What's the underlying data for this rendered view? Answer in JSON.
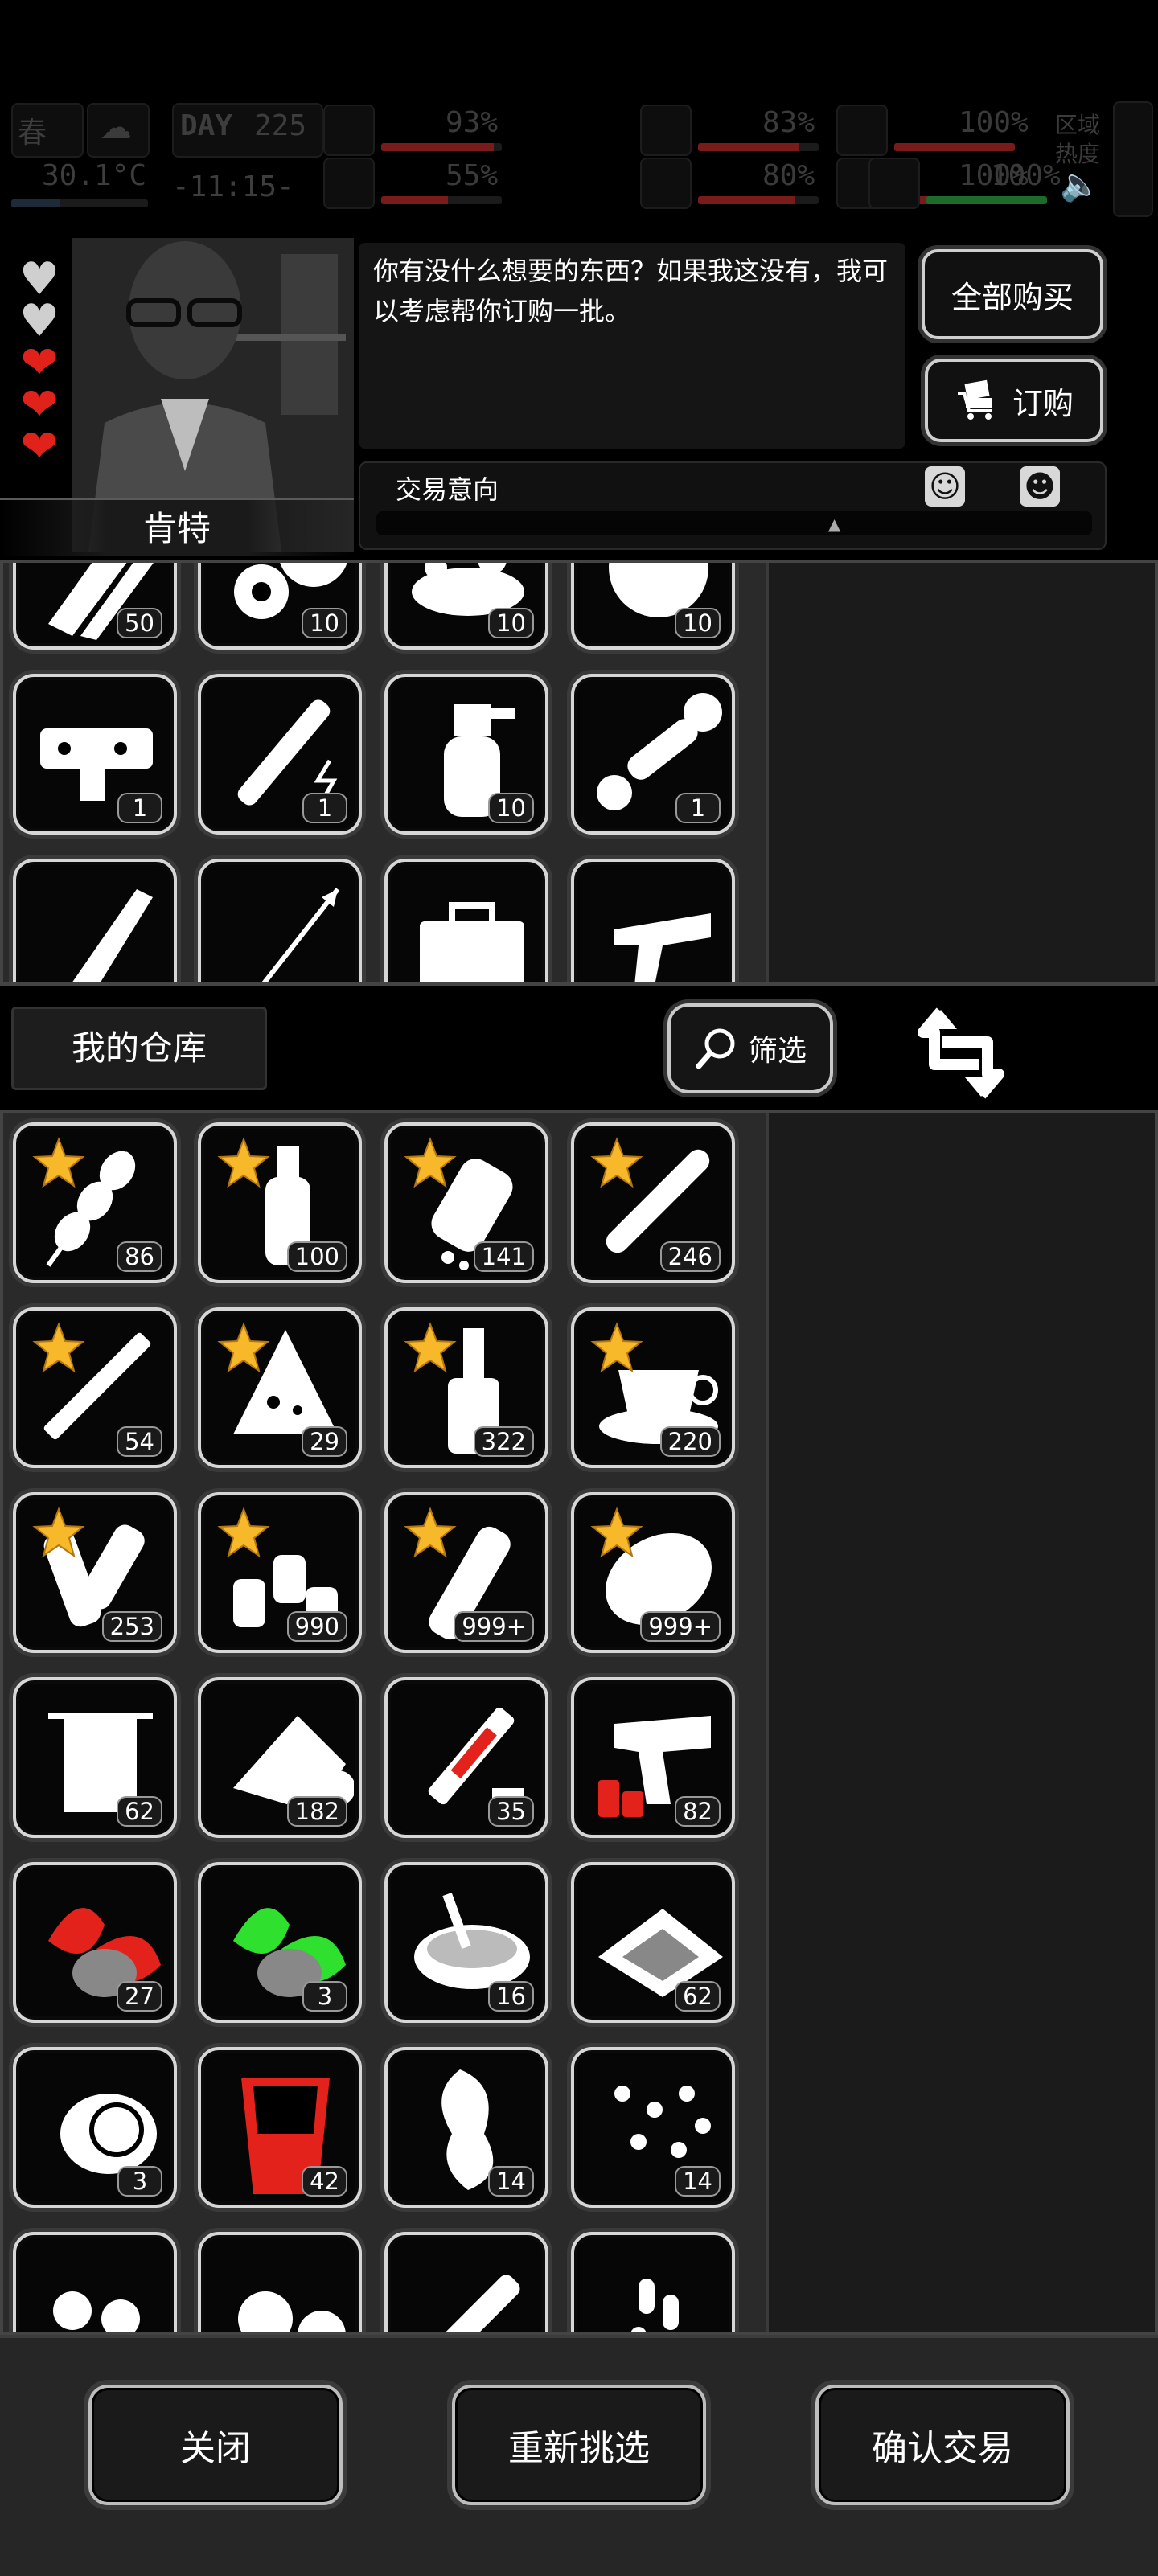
{
  "hud": {
    "season": "春",
    "day_label": "DAY",
    "day": "225",
    "temperature": "30.1°C",
    "time": "-11:15-",
    "stats": [
      {
        "name": "health",
        "value": "93%",
        "fill": 0.93,
        "color": "#7a1b1b"
      },
      {
        "name": "hunger",
        "value": "83%",
        "fill": 0.83,
        "color": "#7a1b1b"
      },
      {
        "name": "stamina",
        "value": "100%",
        "fill": 1.0,
        "color": "#7a1b1b"
      },
      {
        "name": "mood",
        "value": "55%",
        "fill": 0.55,
        "color": "#7a1b1b"
      },
      {
        "name": "thirst",
        "value": "80%",
        "fill": 0.8,
        "color": "#7a1b1b"
      },
      {
        "name": "heart",
        "value": "100%",
        "fill": 1.0,
        "color": "#7a1b1b"
      },
      {
        "name": "sanity",
        "value": "100%",
        "fill": 1.0,
        "color": "#1d6b2a"
      }
    ],
    "zone_heat_label": "区域热度"
  },
  "npc": {
    "name": "肯特",
    "hearts": [
      {
        "icon": "heart-empty-icon",
        "color": "#cfcfcf"
      },
      {
        "icon": "heart-empty-icon",
        "color": "#cfcfcf"
      },
      {
        "icon": "heart-full-icon",
        "color": "#e0221b"
      },
      {
        "icon": "heart-full-icon",
        "color": "#e0221b"
      },
      {
        "icon": "heart-full-icon",
        "color": "#e0221b"
      }
    ],
    "dialogue": "你有没什么想要的东西？如果我这没有，我可以考虑帮你订购一批。",
    "buy_all_label": "全部购买",
    "order_label": "订购",
    "deal_intent_label": "交易意向",
    "deal_intent_level": 0.64
  },
  "trader_items": [
    {
      "icon": "saw-icon",
      "qty": "50"
    },
    {
      "icon": "gears-icon",
      "qty": "10"
    },
    {
      "icon": "scrap-pile-icon",
      "qty": "10"
    },
    {
      "icon": "fur-ball-icon",
      "qty": "10"
    },
    {
      "icon": "gun-trigger-icon",
      "qty": "1"
    },
    {
      "icon": "stun-baton-icon",
      "qty": "1"
    },
    {
      "icon": "spray-bottle-icon",
      "qty": "10"
    },
    {
      "icon": "rifle-scope-icon",
      "qty": "1"
    },
    {
      "icon": "knife-icon",
      "qty": ""
    },
    {
      "icon": "arrow-icon",
      "qty": ""
    },
    {
      "icon": "toolbox-icon",
      "qty": ""
    },
    {
      "icon": "pistol-icon",
      "qty": ""
    }
  ],
  "warehouse": {
    "title": "我的仓库",
    "filter_label": "筛选",
    "items": [
      {
        "icon": "potato-skewer-icon",
        "qty": "86",
        "star": true
      },
      {
        "icon": "water-bottle-icon",
        "qty": "100",
        "star": true
      },
      {
        "icon": "pill-bottle-icon",
        "qty": "141",
        "star": true
      },
      {
        "icon": "cigar-icon",
        "qty": "246",
        "star": true
      },
      {
        "icon": "cigarette-icon",
        "qty": "54",
        "star": true
      },
      {
        "icon": "rice-ball-icon",
        "qty": "29",
        "star": true
      },
      {
        "icon": "liquor-bottle-icon",
        "qty": "322",
        "star": true
      },
      {
        "icon": "coffee-cup-icon",
        "qty": "220",
        "star": true
      },
      {
        "icon": "paper-rolls-icon",
        "qty": "253",
        "star": true
      },
      {
        "icon": "spice-bottles-icon",
        "qty": "990",
        "star": true
      },
      {
        "icon": "glass-bottle-icon",
        "qty": "999+",
        "star": true
      },
      {
        "icon": "potato-icon",
        "qty": "999+",
        "star": true
      },
      {
        "icon": "towel-icon",
        "qty": "62",
        "star": false
      },
      {
        "icon": "bandage-icon",
        "qty": "182",
        "star": false
      },
      {
        "icon": "syringe-icon",
        "qty": "35",
        "star": false
      },
      {
        "icon": "flare-gun-icon",
        "qty": "82",
        "star": false
      },
      {
        "icon": "red-herb-icon",
        "qty": "27",
        "star": false
      },
      {
        "icon": "green-herb-icon",
        "qty": "3",
        "star": false
      },
      {
        "icon": "bowl-icon",
        "qty": "16",
        "star": false
      },
      {
        "icon": "chocolate-icon",
        "qty": "62",
        "star": false
      },
      {
        "icon": "face-mask-icon",
        "qty": "3",
        "star": false
      },
      {
        "icon": "red-cup-icon",
        "qty": "42",
        "star": false
      },
      {
        "icon": "ginseng-icon",
        "qty": "14",
        "star": false
      },
      {
        "icon": "beans-icon",
        "qty": "14",
        "star": false
      },
      {
        "icon": "nuts-icon",
        "qty": "",
        "star": false
      },
      {
        "icon": "pills-icon",
        "qty": "",
        "star": false
      },
      {
        "icon": "dropper-icon",
        "qty": "",
        "star": false
      },
      {
        "icon": "capsules-icon",
        "qty": "",
        "star": false
      }
    ]
  },
  "bottom": {
    "close_label": "关闭",
    "reselect_label": "重新挑选",
    "confirm_label": "确认交易"
  },
  "colors": {
    "star": "#f7b92a",
    "red_accent": "#e3231b",
    "green_accent": "#2fe02f"
  }
}
